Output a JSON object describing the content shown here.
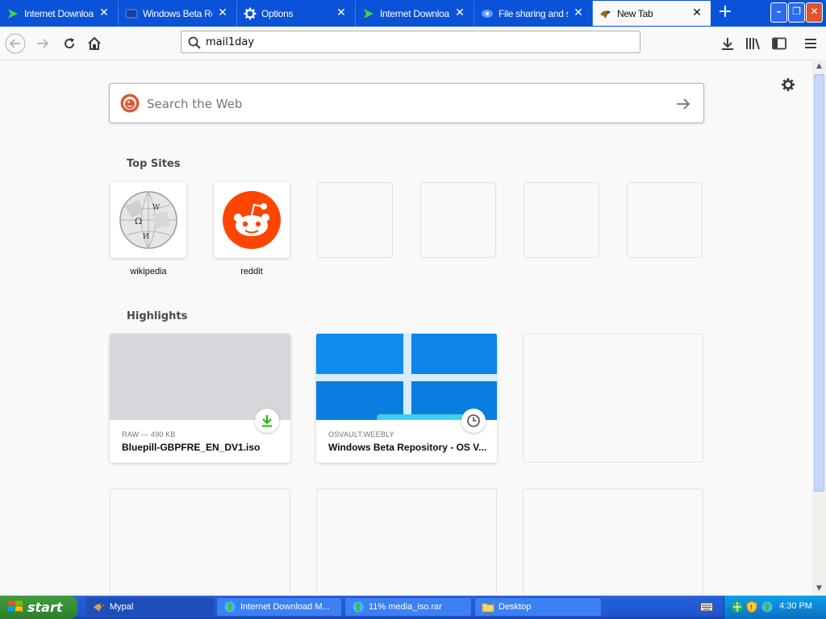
{
  "tabs": [
    {
      "title": "Internet Download",
      "icon": "idm-arrow-icon",
      "active": false
    },
    {
      "title": "Windows Beta Re",
      "icon": "windows-beta-icon",
      "active": false
    },
    {
      "title": "Options",
      "icon": "gear-icon",
      "active": false
    },
    {
      "title": "Internet Download",
      "icon": "idm-arrow-icon",
      "active": false
    },
    {
      "title": "File sharing and st",
      "icon": "file-sharing-icon",
      "active": false
    },
    {
      "title": "New Tab",
      "icon": "mypal-icon",
      "active": true
    }
  ],
  "tab_close_glyph": "✕",
  "new_tab_glyph": "+",
  "window_buttons": {
    "minimize": "–",
    "restore": "❐",
    "close": "✕"
  },
  "url": {
    "value": "mail1day"
  },
  "newtab": {
    "search_placeholder": "Search the Web",
    "top_sites_heading": "Top Sites",
    "top_sites": [
      {
        "label": "wikipedia",
        "icon": "wikipedia-globe-icon"
      },
      {
        "label": "reddit",
        "icon": "reddit-alien-icon"
      },
      {
        "label": ""
      },
      {
        "label": ""
      },
      {
        "label": ""
      },
      {
        "label": ""
      }
    ],
    "highlights_heading": "Highlights",
    "highlights": [
      {
        "context": "RAW — 490 KB",
        "title": "Bluepill-GBPFRE_EN_DV1.iso",
        "badge": "download-icon",
        "thumb_color": "#d7d7db"
      },
      {
        "context": "OSVAULT.WEEBLY",
        "title": "Windows Beta Repository - OS V...",
        "badge": "clock-icon",
        "thumb_color": "#0a7ee0"
      }
    ]
  },
  "taskbar": {
    "start_label": "start",
    "tasks": [
      {
        "label": "Mypal",
        "icon": "mypal-icon",
        "active": true
      },
      {
        "label": "Internet Download M...",
        "icon": "idm-globe-icon",
        "active": false
      },
      {
        "label": "11% media_iso.rar",
        "icon": "idm-globe-icon",
        "active": false
      },
      {
        "label": "Desktop",
        "icon": "folder-icon",
        "active": false
      }
    ],
    "clock": "4:30 PM"
  },
  "colors": {
    "tabbar_bg": "#0a52d8",
    "reddit_orange": "#ff4500",
    "download_green": "#12bc00",
    "taskbar_blue": "#245edc",
    "start_green": "#388e36"
  }
}
